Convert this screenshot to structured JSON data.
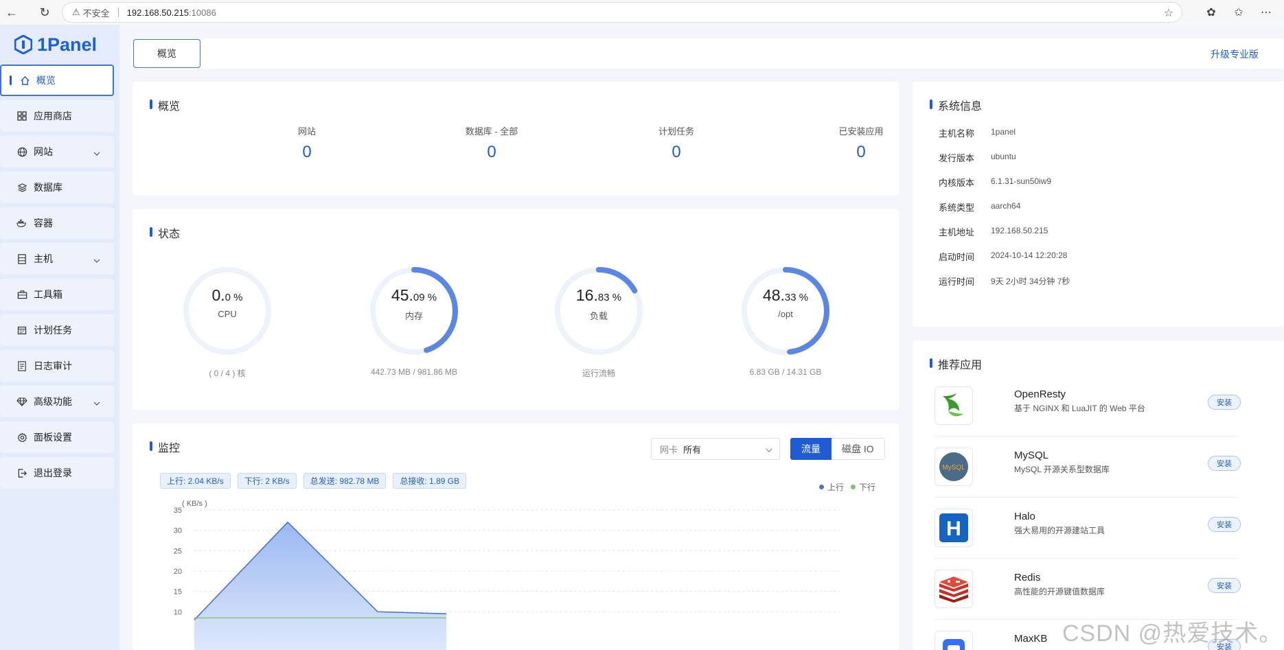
{
  "browser": {
    "insecure_label": "不安全",
    "url_host": "192.168.50.215",
    "url_port": ":10086"
  },
  "brand": {
    "logo_text": "1Panel"
  },
  "sidebar": {
    "items": [
      {
        "label": "概览",
        "icon": "home-icon"
      },
      {
        "label": "应用商店",
        "icon": "grid-icon"
      },
      {
        "label": "网站",
        "icon": "globe-icon"
      },
      {
        "label": "数据库",
        "icon": "layers-icon"
      },
      {
        "label": "容器",
        "icon": "docker-icon"
      },
      {
        "label": "主机",
        "icon": "server-icon"
      },
      {
        "label": "工具箱",
        "icon": "toolbox-icon"
      },
      {
        "label": "计划任务",
        "icon": "calendar-icon"
      },
      {
        "label": "日志审计",
        "icon": "log-icon"
      },
      {
        "label": "高级功能",
        "icon": "diamond-icon"
      },
      {
        "label": "面板设置",
        "icon": "gear-icon"
      },
      {
        "label": "退出登录",
        "icon": "logout-icon"
      }
    ]
  },
  "topbar": {
    "tab": "概览",
    "upgrade": "升级专业版"
  },
  "overview": {
    "title": "概览",
    "items": [
      {
        "label": "网站",
        "value": "0"
      },
      {
        "label": "数据库 - 全部",
        "value": "0"
      },
      {
        "label": "计划任务",
        "value": "0"
      },
      {
        "label": "已安装应用",
        "value": "0"
      }
    ]
  },
  "status": {
    "title": "状态",
    "gauges": [
      {
        "int": "0.",
        "dec": "0 %",
        "label": "CPU",
        "foot": "( 0 / 4 ) 核",
        "percent": 0.0
      },
      {
        "int": "45.",
        "dec": "09 %",
        "label": "内存",
        "foot": "442.73 MB / 981.86 MB",
        "percent": 45.09
      },
      {
        "int": "16.",
        "dec": "83 %",
        "label": "负载",
        "foot": "运行流畅",
        "percent": 16.83
      },
      {
        "int": "48.",
        "dec": "33 %",
        "label": "/opt",
        "foot": "6.83 GB / 14.31 GB",
        "percent": 48.33
      }
    ]
  },
  "monitor": {
    "title": "监控",
    "nic_label": "网卡",
    "nic_value": "所有",
    "btn_traffic": "流量",
    "btn_disk": "磁盘 IO",
    "tags": [
      "上行: 2.04 KB/s",
      "下行: 2 KB/s",
      "总发送: 982.78 MB",
      "总接收: 1.89 GB"
    ],
    "legend_up": "上行",
    "legend_down": "下行"
  },
  "chart_data": {
    "type": "area",
    "ylabel": "( KB/s )",
    "ylim": [
      0,
      35
    ],
    "yticks": [
      10,
      15,
      20,
      25,
      30,
      35
    ],
    "x": [
      0,
      1,
      2,
      3
    ],
    "series": [
      {
        "name": "上行",
        "values": [
          8,
          32,
          10,
          9.5
        ],
        "color": "#4a72d4"
      },
      {
        "name": "下行",
        "values": [
          8.5,
          8.5,
          8.5,
          8.5
        ],
        "color": "#7cc46b"
      }
    ]
  },
  "sysinfo": {
    "title": "系统信息",
    "rows": [
      {
        "key": "主机名称",
        "value": "1panel"
      },
      {
        "key": "发行版本",
        "value": "ubuntu"
      },
      {
        "key": "内核版本",
        "value": "6.1.31-sun50iw9"
      },
      {
        "key": "系统类型",
        "value": "aarch64"
      },
      {
        "key": "主机地址",
        "value": "192.168.50.215"
      },
      {
        "key": "启动时间",
        "value": "2024-10-14 12:20:28"
      },
      {
        "key": "运行时间",
        "value": "9天 2小时 34分钟 7秒"
      }
    ]
  },
  "apps": {
    "title": "推荐应用",
    "install_label": "安装",
    "items": [
      {
        "name": "OpenResty",
        "desc": "基于 NGINX 和 LuaJIT 的 Web 平台",
        "icon": "openresty-icon"
      },
      {
        "name": "MySQL",
        "desc": "MySQL 开源关系型数据库",
        "icon": "mysql-icon",
        "icon_text": "MySQL"
      },
      {
        "name": "Halo",
        "desc": "强大易用的开源建站工具",
        "icon": "halo-icon",
        "icon_text": "H"
      },
      {
        "name": "Redis",
        "desc": "高性能的开源键值数据库",
        "icon": "redis-icon"
      },
      {
        "name": "MaxKB",
        "desc": "",
        "icon": "maxkb-icon"
      }
    ]
  },
  "watermark": "CSDN @热爱技术。"
}
